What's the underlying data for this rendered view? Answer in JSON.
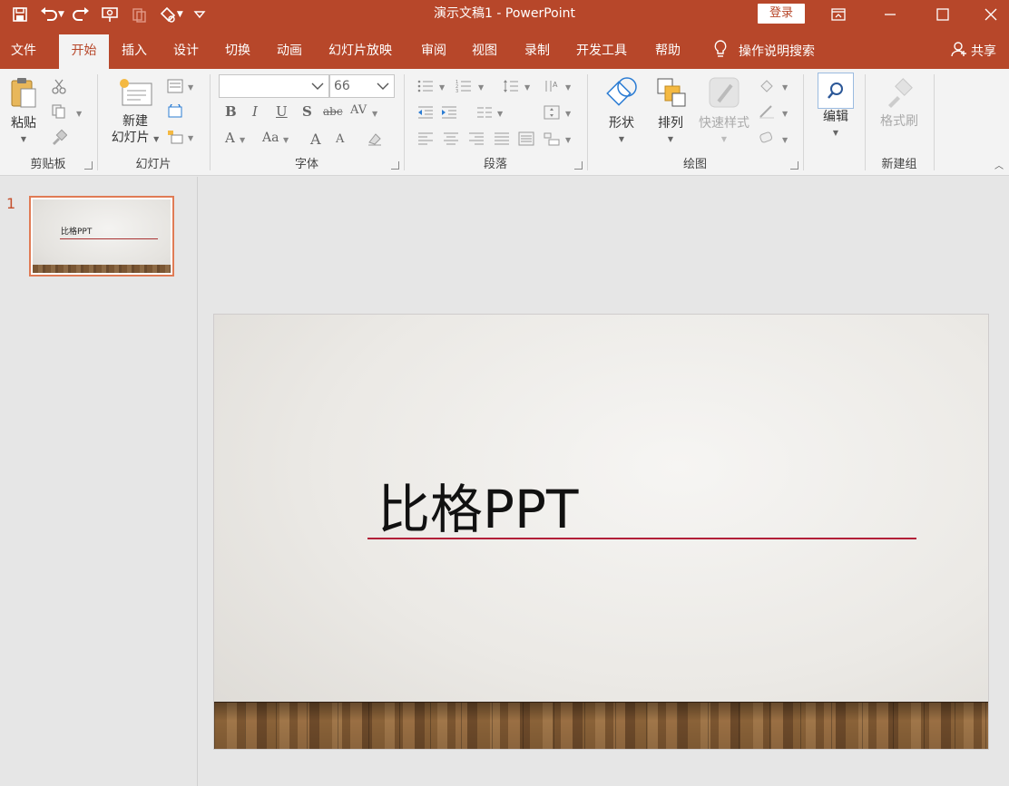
{
  "window": {
    "title": "演示文稿1  -  PowerPoint",
    "login_label": "登录",
    "accent": "#b7472a"
  },
  "qat": {
    "icons": [
      "save-icon",
      "undo-icon",
      "redo-icon",
      "present-icon",
      "paste-disabled-icon",
      "touch-mode-icon",
      "customize-icon"
    ]
  },
  "tabs": [
    "文件",
    "开始",
    "插入",
    "设计",
    "切换",
    "动画",
    "幻灯片放映",
    "审阅",
    "视图",
    "录制",
    "开发工具",
    "帮助"
  ],
  "active_tab": "开始",
  "tell_me": "操作说明搜索",
  "share": "共享",
  "ribbon": {
    "clipboard": {
      "label": "剪贴板",
      "paste": "粘贴"
    },
    "slides": {
      "label": "幻灯片",
      "new_slide_line1": "新建",
      "new_slide_line2": "幻灯片"
    },
    "font": {
      "label": "字体",
      "font_name": "",
      "font_size": "66"
    },
    "paragraph": {
      "label": "段落"
    },
    "drawing": {
      "label": "绘图",
      "shapes": "形状",
      "arrange": "排列",
      "quick_styles": "快速样式"
    },
    "editing": {
      "edit": "编辑"
    },
    "newgroup": {
      "label": "新建组",
      "format_painter": "格式刷"
    }
  },
  "slides_pane": {
    "slide_number": "1",
    "thumb_title": "比格PPT"
  },
  "slide": {
    "title": "比格PPT",
    "line_color": "#b21f38"
  }
}
